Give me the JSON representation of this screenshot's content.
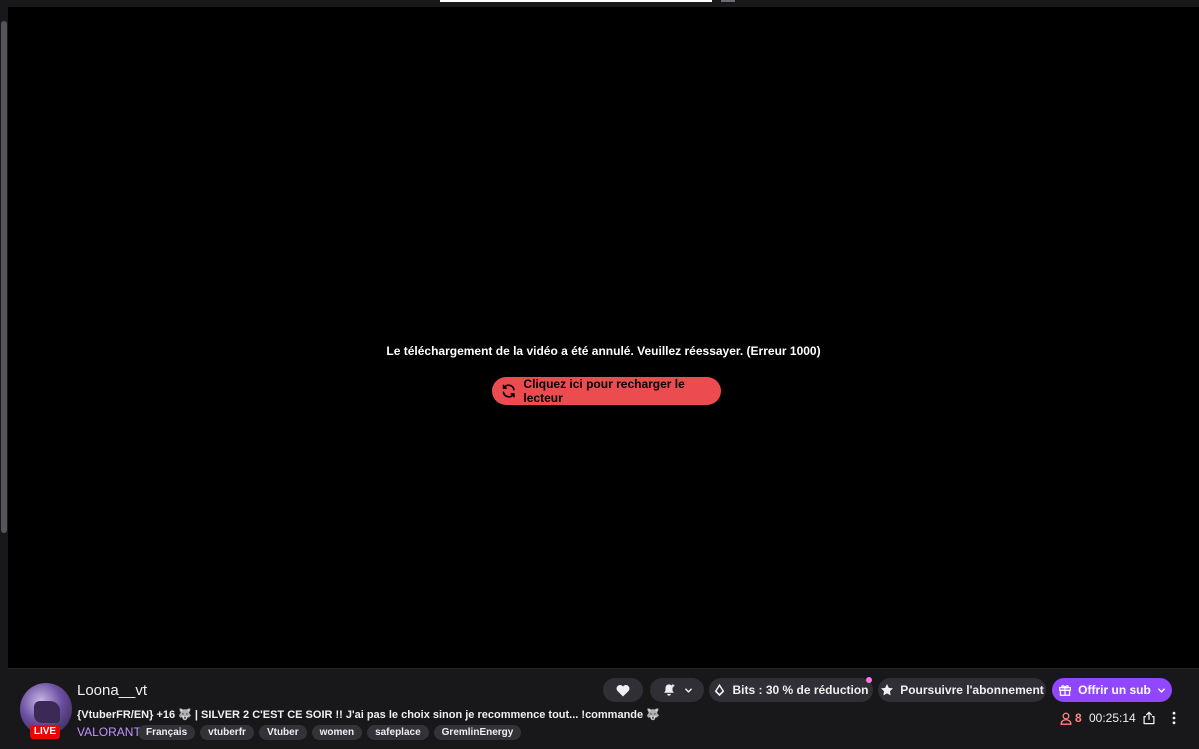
{
  "player": {
    "error_message": "Le téléchargement de la vidéo a été annulé. Veuillez réessayer. (Erreur 1000)",
    "reload_label": "Cliquez ici pour recharger le lecteur"
  },
  "channel": {
    "name": "Loona__vt",
    "live_label": "LIVE",
    "title": "{VtuberFR/EN} +16 🐺 | SILVER 2 C'EST CE SOIR !! J'ai pas le choix sinon je recommence tout... !commande 🐺",
    "game": "VALORANT",
    "tags": [
      "Français",
      "vtuberfr",
      "Vtuber",
      "women",
      "safeplace",
      "GremlinEnergy"
    ]
  },
  "actions": {
    "bits_label": "Bits : 30 % de réduction",
    "resub_label": "Poursuivre l'abonnement",
    "gift_label": "Offrir un sub"
  },
  "stats": {
    "viewers": "8",
    "uptime": "00:25:14"
  },
  "colors": {
    "accent": "#9147ff",
    "reload_button": "#ec4b4f",
    "live": "#eb0400",
    "game_link": "#bf94ff"
  }
}
